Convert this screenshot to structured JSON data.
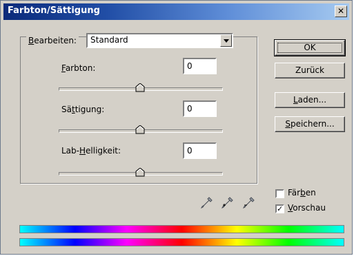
{
  "window": {
    "title": "Farbton/Sättigung",
    "close_label": "✕"
  },
  "edit": {
    "label": "Bearbeiten:",
    "selected": "Standard"
  },
  "hue": {
    "label": "Farbton:",
    "value": "0",
    "slider_fraction": 0.5
  },
  "saturation": {
    "label": "Sättigung:",
    "value": "0",
    "slider_fraction": 0.5
  },
  "lightness": {
    "label": "Lab-Helligkeit:",
    "value": "0",
    "slider_fraction": 0.5
  },
  "buttons": {
    "ok": "OK",
    "back": "Zurück",
    "load": "Laden...",
    "save": "Speichern..."
  },
  "options": {
    "colorize": {
      "label": "Färben",
      "checked": false
    },
    "preview": {
      "label": "Vorschau",
      "checked": true
    }
  },
  "icons": [
    "eyedropper-icon",
    "eyedropper-plus-icon",
    "eyedropper-minus-icon"
  ]
}
